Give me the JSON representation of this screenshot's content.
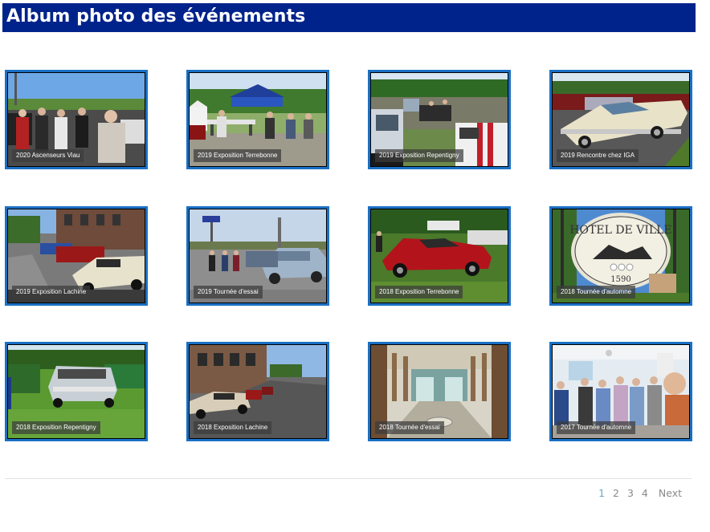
{
  "page_title": "Album photo des événements",
  "albums": [
    {
      "caption": "2020 Ascenseurs Viau"
    },
    {
      "caption": "2019 Exposition Terrebonne"
    },
    {
      "caption": "2019 Exposition Repentigny"
    },
    {
      "caption": "2019 Rencontre chez IGA"
    },
    {
      "caption": "2019 Exposition Lachine"
    },
    {
      "caption": "2019 Tournée d'essai"
    },
    {
      "caption": "2018 Exposition Terrebonne"
    },
    {
      "caption": "2018 Tournée d'automne"
    },
    {
      "caption": "2018 Exposition Repentigny"
    },
    {
      "caption": "2018 Exposition Lachine"
    },
    {
      "caption": "2018 Tournée d'essai"
    },
    {
      "caption": "2017 Tournée d'automne"
    }
  ],
  "pagination": {
    "pages": [
      "1",
      "2",
      "3",
      "4"
    ],
    "current": "1",
    "next_label": "Next"
  },
  "colors": {
    "header_bg": "#00238b",
    "card_border": "#1a70c4",
    "pager_current": "#6ba5c9",
    "pager_text": "#8a8a8a"
  }
}
